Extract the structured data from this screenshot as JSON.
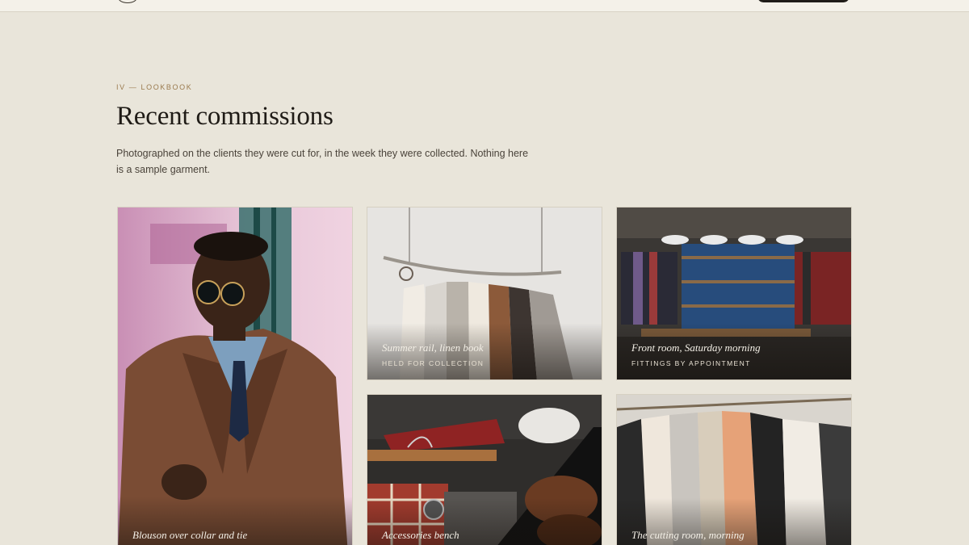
{
  "header": {
    "logo_icon": "monogram-circle-icon"
  },
  "section": {
    "eyebrow": "IV — LOOKBOOK",
    "title": "Recent commissions",
    "intro": "Photographed on the clients they were cut for, in the week they were collected. Nothing here is a sample garment."
  },
  "gallery": {
    "items": [
      {
        "title": "Blouson over collar and tie",
        "subtitle": ""
      },
      {
        "title": "Summer rail, linen book",
        "subtitle": "HELD FOR COLLECTION"
      },
      {
        "title": "Front room, Saturday morning",
        "subtitle": "FITTINGS BY APPOINTMENT"
      },
      {
        "title": "Accessories bench",
        "subtitle": ""
      },
      {
        "title": "The cutting room, morning",
        "subtitle": ""
      }
    ]
  },
  "colors": {
    "background": "#e9e5da",
    "eyebrow_accent": "#9a7a4e",
    "heading": "#1f1b16"
  }
}
